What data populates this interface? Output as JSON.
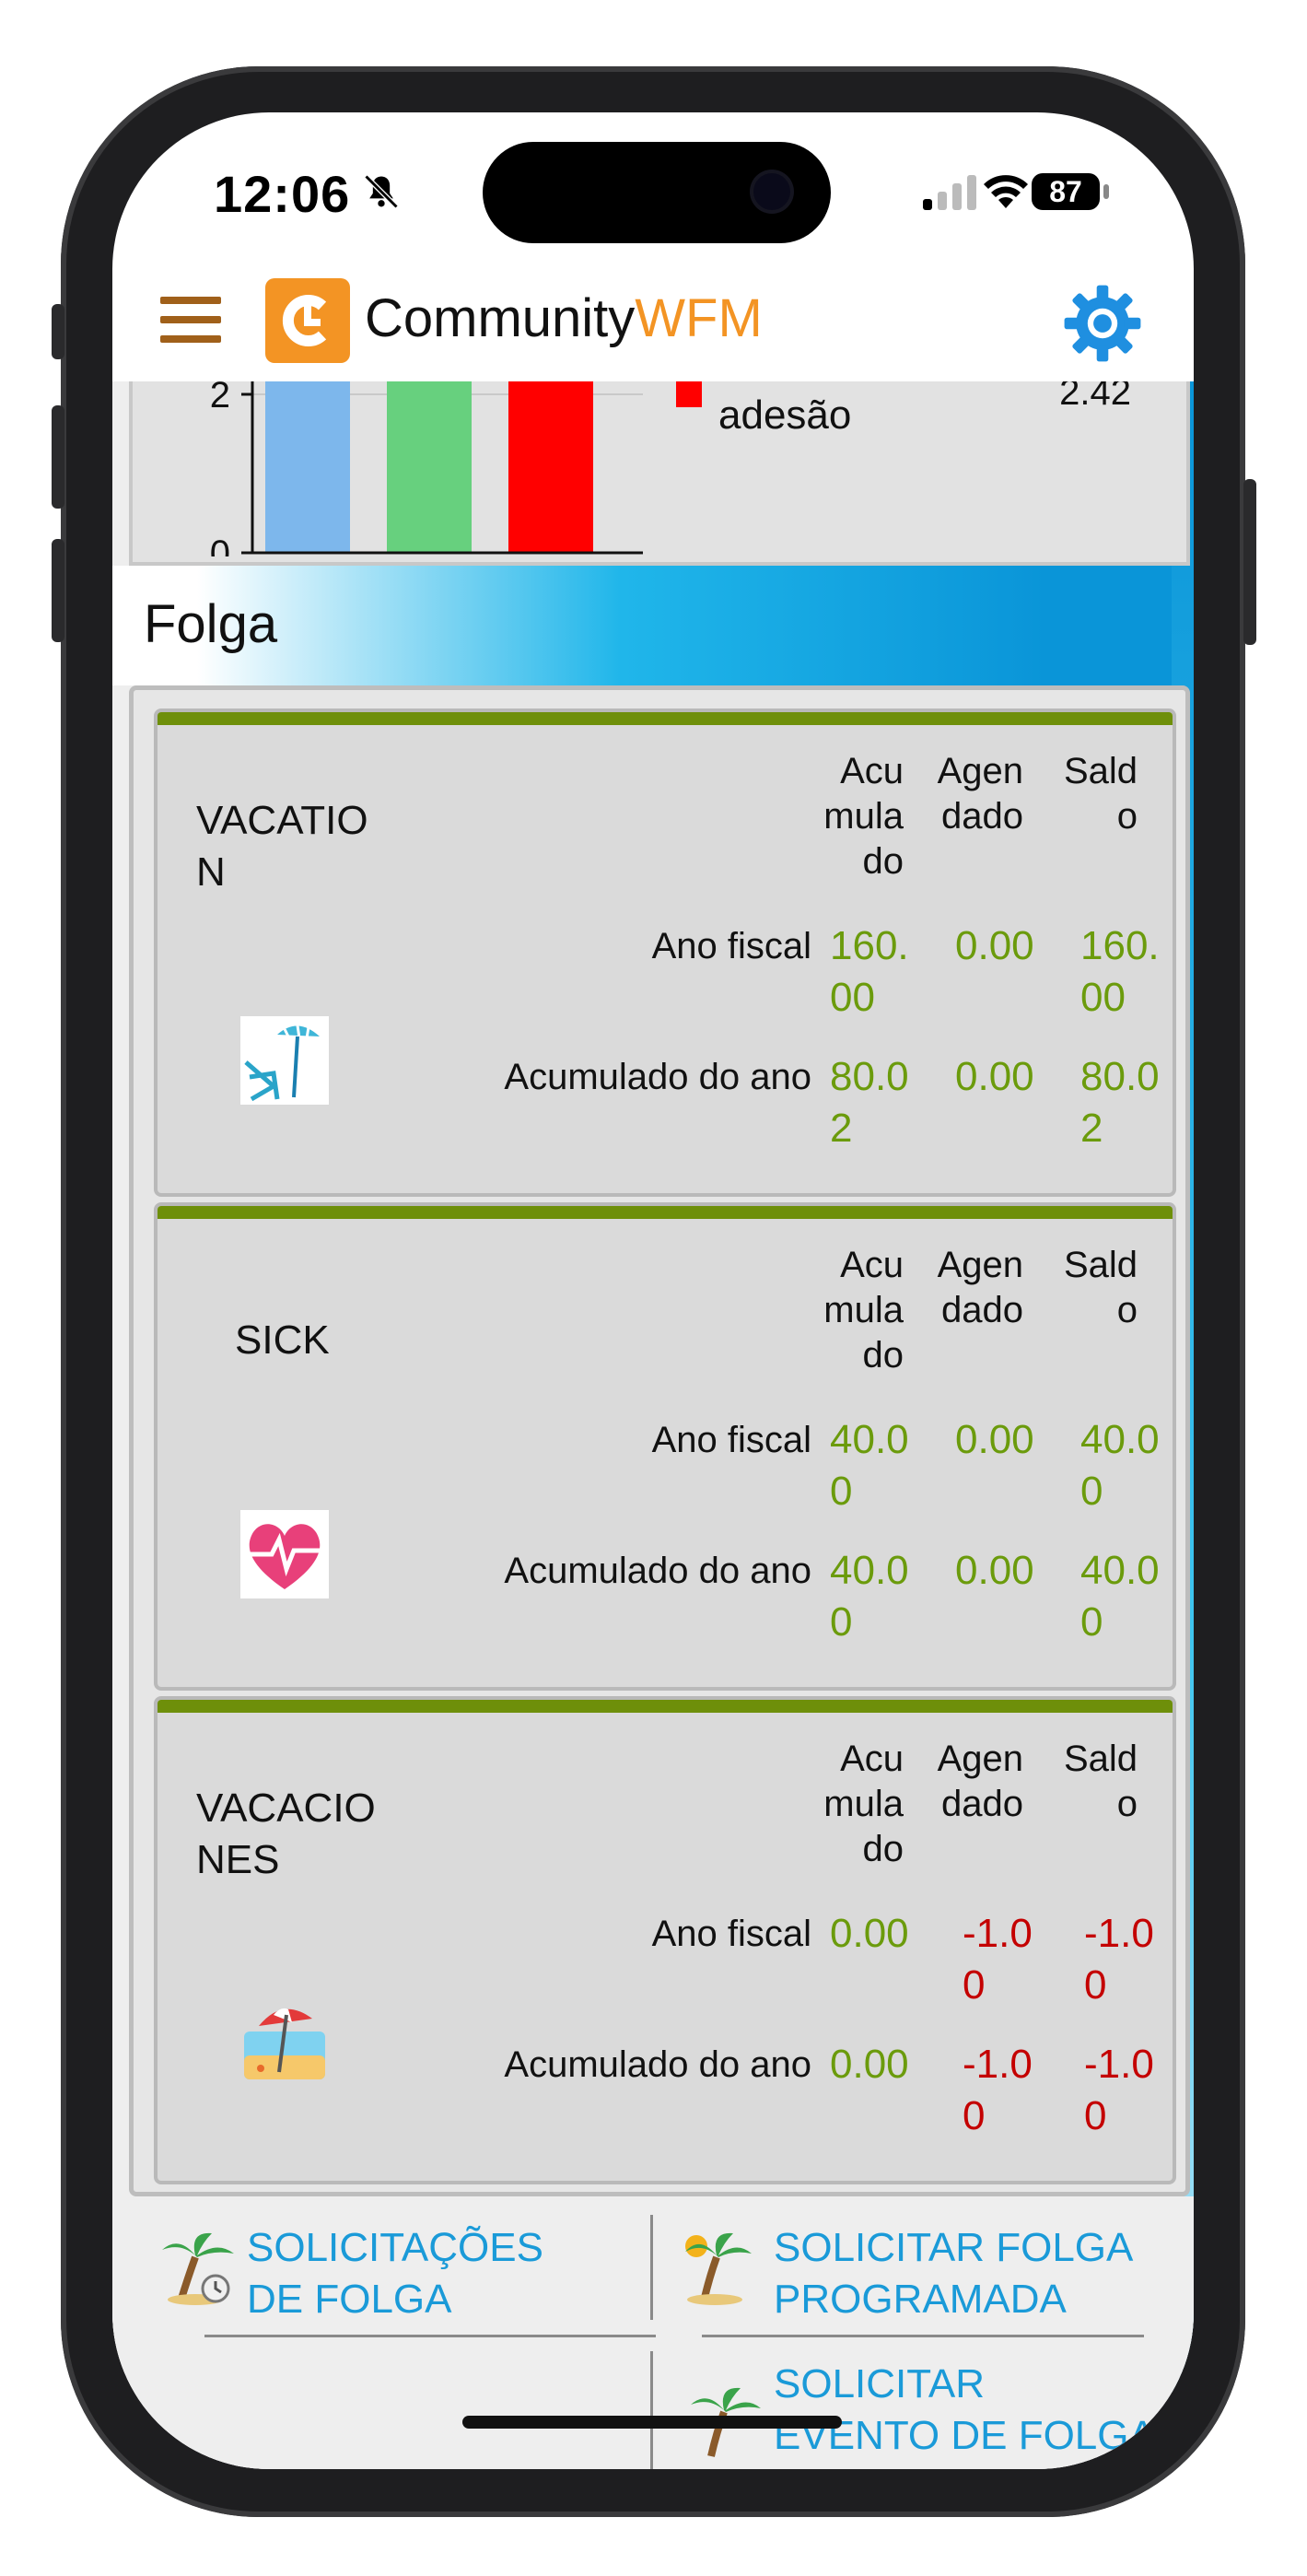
{
  "status_bar": {
    "time": "12:06",
    "battery": "87",
    "icons": [
      "bell-slash-icon",
      "cellular-signal-icon",
      "wifi-icon",
      "battery-icon"
    ]
  },
  "app_header": {
    "brand_part1": "Community",
    "brand_part2": "WFM",
    "brand_color": "#f39424",
    "menu_icon": "hamburger-menu-icon",
    "settings_icon": "gear-icon"
  },
  "adherence_chart": {
    "legend_label": "adesão",
    "value": "2.42",
    "y_ticks": [
      "2",
      "0"
    ],
    "colors": [
      "#7db7ec",
      "#67d07e",
      "#ff0000"
    ]
  },
  "chart_data": {
    "type": "bar",
    "categories": [
      "",
      "",
      ""
    ],
    "values": [
      2.9,
      2.9,
      2.7
    ],
    "ylim": [
      0,
      3
    ],
    "title": "",
    "xlabel": "",
    "ylabel": ""
  },
  "folga": {
    "title": "Folga",
    "col_headers": [
      "Acu\nmula\ndo",
      "Agen\ndado",
      "Sald\no"
    ],
    "row_labels": [
      "Ano fiscal",
      "Acumulado do ano"
    ],
    "cards": [
      {
        "name": "VACATIO\nN",
        "icon": "beach-chair-umbrella-icon",
        "rows": [
          {
            "acumulado": "160.\n00",
            "agendado": "0.00",
            "saldo": "160.\n00",
            "colors": [
              "green",
              "green",
              "green"
            ]
          },
          {
            "acumulado": "80.0\n2",
            "agendado": "0.00",
            "saldo": "80.0\n2",
            "colors": [
              "green",
              "green",
              "green"
            ]
          }
        ]
      },
      {
        "name": "SICK",
        "icon": "heart-pulse-icon",
        "rows": [
          {
            "acumulado": "40.0\n0",
            "agendado": "0.00",
            "saldo": "40.0\n0",
            "colors": [
              "green",
              "green",
              "green"
            ]
          },
          {
            "acumulado": "40.0\n0",
            "agendado": "0.00",
            "saldo": "40.0\n0",
            "colors": [
              "green",
              "green",
              "green"
            ]
          }
        ]
      },
      {
        "name": "VACACIO\nNES",
        "icon": "beach-umbrella-icon",
        "rows": [
          {
            "acumulado": "0.00",
            "agendado": "-1.0\n0",
            "saldo": "-1.0\n0",
            "colors": [
              "green",
              "red",
              "red"
            ]
          },
          {
            "acumulado": "0.00",
            "agendado": "-1.0\n0",
            "saldo": "-1.0\n0",
            "colors": [
              "green",
              "red",
              "red"
            ]
          }
        ]
      }
    ]
  },
  "links": {
    "requests": "SOLICITAÇÕES\nDE FOLGA",
    "request_planned": "SOLICITAR FOLGA\nPROGRAMADA",
    "request_recurring": "SOLICITAR\nEVENTO DE FOLGA\nRECORRENTE"
  }
}
